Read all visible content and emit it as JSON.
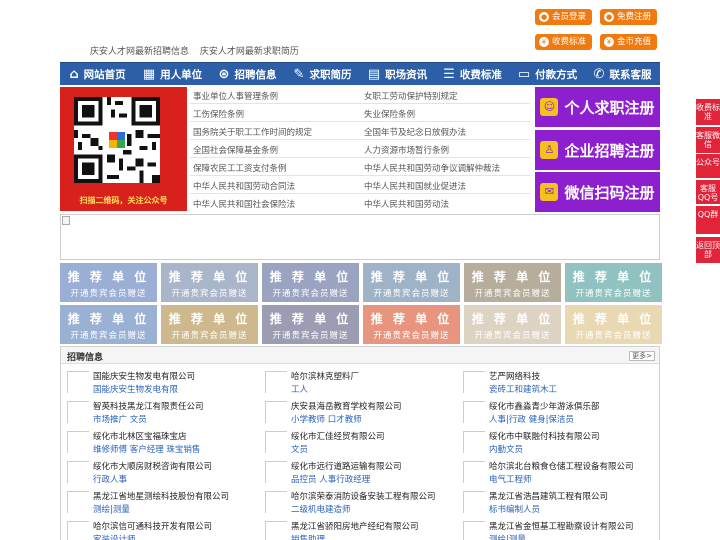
{
  "header": {
    "links": [
      "庆安人才网最新招聘信息",
      "庆安人才网最新求职简历"
    ],
    "buttons": [
      {
        "label": "会员登录",
        "icon": "user-icon"
      },
      {
        "label": "免费注册",
        "icon": "register-icon"
      },
      {
        "label": "收费标准",
        "icon": "price-icon"
      },
      {
        "label": "金币充值",
        "icon": "coin-icon"
      }
    ]
  },
  "nav": [
    {
      "label": "网站首页",
      "icon": "home-icon"
    },
    {
      "label": "用人单位",
      "icon": "building-icon"
    },
    {
      "label": "招聘信息",
      "icon": "recruit-icon"
    },
    {
      "label": "求职简历",
      "icon": "resume-icon"
    },
    {
      "label": "职场资讯",
      "icon": "news-icon"
    },
    {
      "label": "收费标准",
      "icon": "fee-icon"
    },
    {
      "label": "付款方式",
      "icon": "payment-icon"
    },
    {
      "label": "联系客服",
      "icon": "service-icon"
    }
  ],
  "qr_caption": "扫描二维码，关注公众号",
  "laws": {
    "left": [
      "事业单位人事管理条例",
      "工伤保险条例",
      "国务院关于职工工作时间的规定",
      "全国社会保障基金条例",
      "保障农民工工资支付条例",
      "中华人民共和国劳动合同法",
      "中华人民共和国社会保险法"
    ],
    "right": [
      "女职工劳动保护特别规定",
      "失业保险条例",
      "全国年节及纪念日放假办法",
      "人力资源市场暂行条例",
      "中华人民共和国劳动争议调解仲裁法",
      "中华人民共和国就业促进法",
      "中华人民共和国劳动法"
    ]
  },
  "register": [
    {
      "label": "个人求职注册",
      "icon": "person-icon"
    },
    {
      "label": "企业招聘注册",
      "icon": "company-icon"
    },
    {
      "label": "微信扫码注册",
      "icon": "wechat-icon"
    }
  ],
  "recommend": {
    "title": "推 荐 单 位",
    "sub": "开通贵宾会员赠送",
    "colors": [
      "#9aaed6",
      "#a9b6c9",
      "#9aa3bf",
      "#9fb3c6",
      "#b6ad9c",
      "#8fc2c0",
      "#9bb1d4",
      "#cdb98d",
      "#9c9cb3",
      "#e7957f",
      "#ddd3c3",
      "#e9d9b3"
    ]
  },
  "jobs": {
    "title": "招聘信息",
    "more": "更多>",
    "items": [
      {
        "company": "国能庆安生物发电有限公司",
        "position": "国能庆安生物发电有限"
      },
      {
        "company": "哈尔滨林克塑料厂",
        "position": "工人"
      },
      {
        "company": "艺严网络科技",
        "position": "瓷砖工和建筑木工"
      },
      {
        "company": "智英科技黑龙江有限责任公司",
        "position": "市场推广  文员"
      },
      {
        "company": "庆安县海岳教育学校有限公司",
        "position": "小学教师  口才教师"
      },
      {
        "company": "绥化市鑫淼青少年游泳俱乐部",
        "position": "人事|行政  健身|保洁员"
      },
      {
        "company": "绥化市北林区宝福珠宝店",
        "position": "维修师傅  客户经理  珠宝销售"
      },
      {
        "company": "绥化市汇佳经贸有限公司",
        "position": "文员"
      },
      {
        "company": "绥化市中联融付科技有限公司",
        "position": "内勤文员"
      },
      {
        "company": "绥化市大顺房财税咨询有限公司",
        "position": "行政人事"
      },
      {
        "company": "绥化市远行道路运输有限公司",
        "position": "品控员  人事行政经理"
      },
      {
        "company": "哈尔滨北台粮食仓储工程设备有限公司",
        "position": "电气工程师"
      },
      {
        "company": "黑龙江省地星测绘科技股份有限公司",
        "position": "测绘|测量"
      },
      {
        "company": "哈尔滨荣泰消防设备安装工程有限公司",
        "position": "二级机电建造师"
      },
      {
        "company": "黑龙江省浩昌建筑工程有限公司",
        "position": "标书编制人员"
      },
      {
        "company": "哈尔滨信可通科技开发有限公司",
        "position": "家装设计师"
      },
      {
        "company": "黑龙江省骄阳房地产经纪有限公司",
        "position": "销售助理"
      },
      {
        "company": "黑龙江省金恒基工程勘察设计有限公司",
        "position": "测绘|测量"
      }
    ]
  },
  "side": [
    "收费标准",
    "客服微信",
    "公众号",
    "客服QQ号",
    "QQ群",
    "返回顶部"
  ]
}
